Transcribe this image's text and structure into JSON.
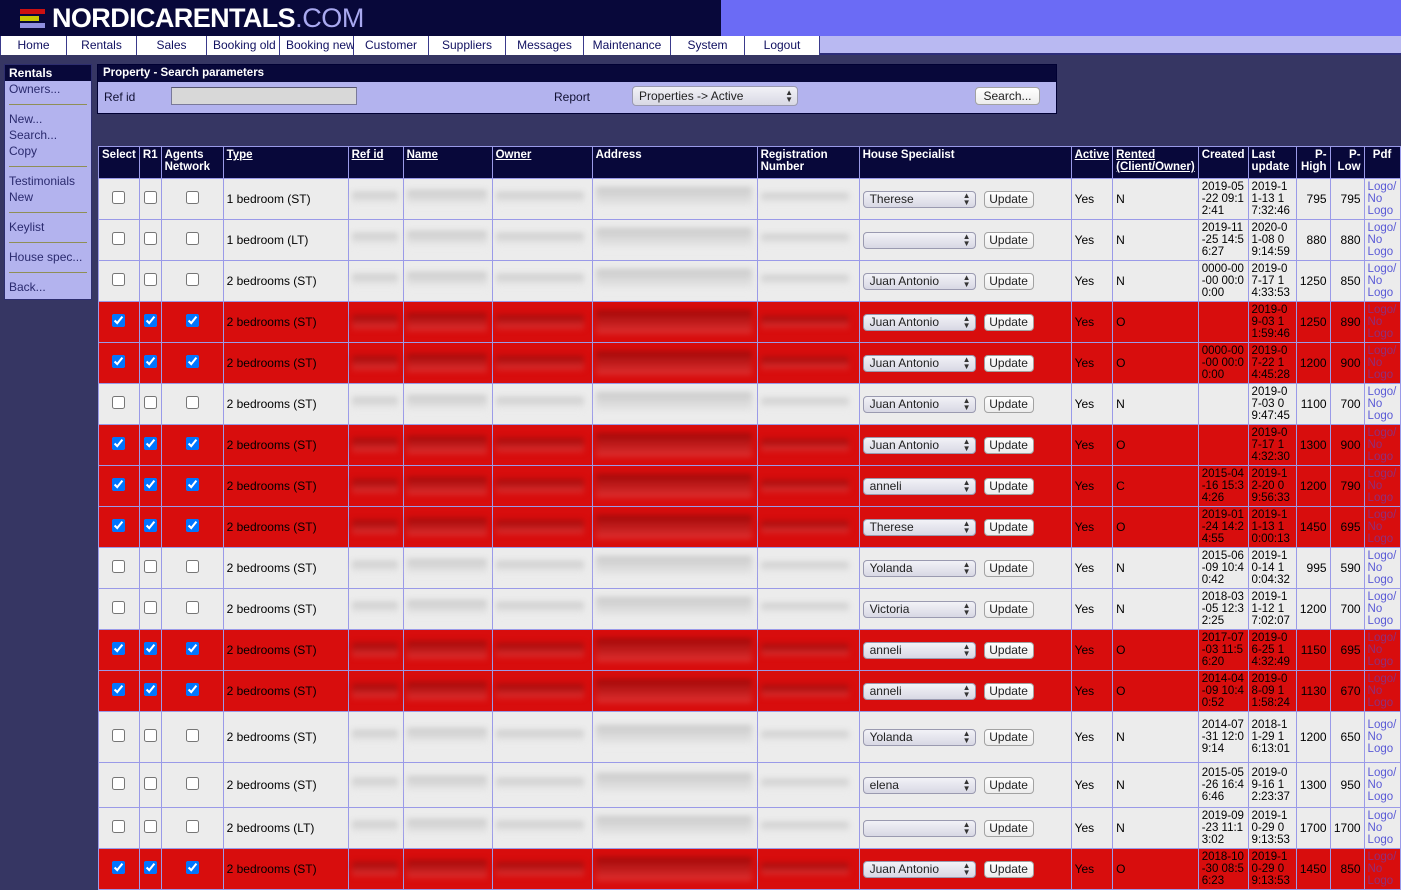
{
  "brand": {
    "name_main": "NORDICARENTALS",
    "name_suffix": ".COM",
    "bar_colors": [
      "#cc1111",
      "#c8c800",
      "#8f8fe0"
    ]
  },
  "nav": {
    "items": [
      {
        "label": "Home"
      },
      {
        "label": "Rentals"
      },
      {
        "label": "Sales"
      },
      {
        "label": "Booking old"
      },
      {
        "label": "Booking new"
      },
      {
        "label": "Customer"
      },
      {
        "label": "Suppliers"
      },
      {
        "label": "Messages"
      },
      {
        "label": "Maintenance"
      },
      {
        "label": "System"
      },
      {
        "label": "Logout"
      }
    ]
  },
  "sidebar": {
    "title": "Rentals",
    "groups": [
      [
        "Owners..."
      ],
      [
        "New...",
        "Search...",
        "Copy"
      ],
      [
        "Testimonials",
        "New"
      ],
      [
        "Keylist"
      ],
      [
        "House spec..."
      ],
      [
        "Back..."
      ]
    ]
  },
  "search_panel": {
    "title": "Property - Search parameters",
    "refid_label": "Ref id",
    "refid_value": "",
    "refid_placeholder": "",
    "report_label": "Report",
    "report_selected": "Properties -> Active",
    "search_button": "Search..."
  },
  "table": {
    "headers": {
      "select": "Select",
      "r1": "R1",
      "agents": "Agents Network",
      "type": "Type",
      "refid": "Ref id",
      "name": "Name",
      "owner": "Owner",
      "address": "Address",
      "registration": "Registration Number",
      "house_specialist": "House Specialist",
      "active": "Active",
      "rented": "Rented (Client/Owner)",
      "created": "Created",
      "last_update": "Last update",
      "p_high": "P-High",
      "p_low": "P-Low",
      "pdf": "Pdf"
    },
    "update_label": "Update",
    "pdf_links": [
      "Logo/",
      "No",
      "Logo"
    ],
    "rows": [
      {
        "flag": false,
        "checked": false,
        "type": "1 bedroom (ST)",
        "specialist": "Therese",
        "active": "Yes",
        "rented": "N",
        "created": "2019-05-22 09:12:41",
        "updated": "2019-11-13 17:32:46",
        "phigh": "795",
        "plow": "795"
      },
      {
        "flag": false,
        "checked": false,
        "type": "1 bedroom (LT)",
        "specialist": "",
        "active": "Yes",
        "rented": "N",
        "created": "2019-11-25 14:56:27",
        "updated": "2020-01-08 09:14:59",
        "phigh": "880",
        "plow": "880"
      },
      {
        "flag": false,
        "checked": false,
        "type": "2 bedrooms (ST)",
        "specialist": "Juan Antonio",
        "active": "Yes",
        "rented": "N",
        "created": "0000-00-00 00:00:00",
        "updated": "2019-07-17 14:33:53",
        "phigh": "1250",
        "plow": "850"
      },
      {
        "flag": true,
        "checked": true,
        "type": "2 bedrooms (ST)",
        "specialist": "Juan Antonio",
        "active": "Yes",
        "rented": "O",
        "created": "",
        "updated": "2019-09-03 11:59:46",
        "phigh": "1250",
        "plow": "890"
      },
      {
        "flag": true,
        "checked": true,
        "type": "2 bedrooms (ST)",
        "specialist": "Juan Antonio",
        "active": "Yes",
        "rented": "O",
        "created": "0000-00-00 00:00:00",
        "updated": "2019-07-22 14:45:28",
        "phigh": "1200",
        "plow": "900"
      },
      {
        "flag": false,
        "checked": false,
        "type": "2 bedrooms (ST)",
        "specialist": "Juan Antonio",
        "active": "Yes",
        "rented": "N",
        "created": "",
        "updated": "2019-07-03 09:47:45",
        "phigh": "1100",
        "plow": "700"
      },
      {
        "flag": true,
        "checked": true,
        "type": "2 bedrooms (ST)",
        "specialist": "Juan Antonio",
        "active": "Yes",
        "rented": "O",
        "created": "",
        "updated": "2019-07-17 14:32:30",
        "phigh": "1300",
        "plow": "900"
      },
      {
        "flag": true,
        "checked": true,
        "type": "2 bedrooms (ST)",
        "specialist": "anneli",
        "active": "Yes",
        "rented": "C",
        "created": "2015-04-16 15:34:26",
        "updated": "2019-12-20 09:56:33",
        "phigh": "1200",
        "plow": "790"
      },
      {
        "flag": true,
        "checked": true,
        "type": "2 bedrooms (ST)",
        "specialist": "Therese",
        "active": "Yes",
        "rented": "O",
        "created": "2019-01-24 14:24:55",
        "updated": "2019-11-13 10:00:13",
        "phigh": "1450",
        "plow": "695"
      },
      {
        "flag": false,
        "checked": false,
        "type": "2 bedrooms (ST)",
        "specialist": "Yolanda",
        "active": "Yes",
        "rented": "N",
        "created": "2015-06-09 10:40:42",
        "updated": "2019-10-14 10:04:32",
        "phigh": "995",
        "plow": "590"
      },
      {
        "flag": false,
        "checked": false,
        "type": "2 bedrooms (ST)",
        "specialist": "Victoria",
        "active": "Yes",
        "rented": "N",
        "created": "2018-03-05 12:32:25",
        "updated": "2019-11-12 17:02:07",
        "phigh": "1200",
        "plow": "700"
      },
      {
        "flag": true,
        "checked": true,
        "type": "2 bedrooms (ST)",
        "specialist": "anneli",
        "active": "Yes",
        "rented": "O",
        "created": "2017-07-03 11:56:20",
        "updated": "2019-06-25 14:32:49",
        "phigh": "1150",
        "plow": "695"
      },
      {
        "flag": true,
        "checked": true,
        "type": "2 bedrooms (ST)",
        "specialist": "anneli",
        "active": "Yes",
        "rented": "O",
        "created": "2014-04-09 10:40:52",
        "updated": "2019-08-09 11:58:24",
        "phigh": "1130",
        "plow": "670"
      },
      {
        "flag": false,
        "checked": false,
        "type": "2 bedrooms (ST)",
        "specialist": "Yolanda",
        "active": "Yes",
        "rented": "N",
        "created": "2014-07-31 12:09:14",
        "updated": "2018-11-29 16:13:01",
        "phigh": "1200",
        "plow": "650"
      },
      {
        "flag": false,
        "checked": false,
        "type": "2 bedrooms (ST)",
        "specialist": "elena",
        "active": "Yes",
        "rented": "N",
        "created": "2015-05-26 16:46:46",
        "updated": "2019-09-16 12:23:37",
        "phigh": "1300",
        "plow": "950"
      },
      {
        "flag": false,
        "checked": false,
        "type": "2 bedrooms (LT)",
        "specialist": "",
        "active": "Yes",
        "rented": "N",
        "created": "2019-09-23 11:13:02",
        "updated": "2019-10-29 09:13:53",
        "phigh": "1700",
        "plow": "1700"
      },
      {
        "flag": true,
        "checked": true,
        "type": "2 bedrooms (ST)",
        "specialist": "Juan Antonio",
        "active": "Yes",
        "rented": "O",
        "created": "2018-10-30 08:56:23",
        "updated": "2019-10-29 09:13:53",
        "phigh": "1450",
        "plow": "850"
      }
    ]
  },
  "colors": {
    "banner_dark": "#08083a",
    "banner_light": "#6b6bf5",
    "page_bg": "#363663",
    "sidebar_bg": "#b3b3ee",
    "flag_row": "#d80d0d",
    "row_bg": "#ececec",
    "link": "#5a5ad6"
  }
}
